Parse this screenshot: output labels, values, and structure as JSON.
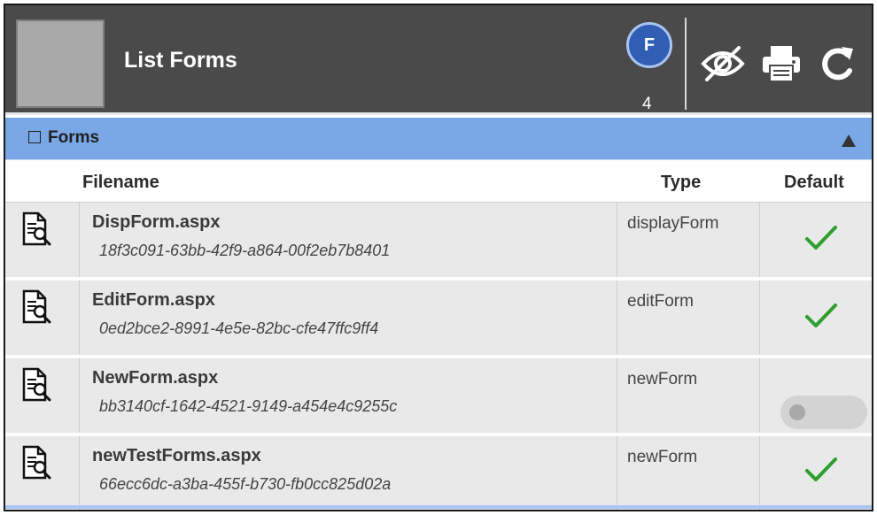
{
  "header": {
    "title": "List Forms",
    "badge_letter": "F",
    "badge_count": "4",
    "icons": [
      "hide-eye-icon",
      "print-icon",
      "refresh-icon"
    ]
  },
  "section": {
    "title": "Forms",
    "collapsed": false
  },
  "columns": {
    "filename": "Filename",
    "type": "Type",
    "default": "Default"
  },
  "rows": [
    {
      "name": "DispForm.aspx",
      "id": "18f3c091-63bb-42f9-a864-00f2eb7b8401",
      "type": "displayForm",
      "default": true
    },
    {
      "name": "EditForm.aspx",
      "id": "0ed2bce2-8991-4e5e-82bc-cfe47ffc9ff4",
      "type": "editForm",
      "default": true
    },
    {
      "name": "NewForm.aspx",
      "id": "bb3140cf-1642-4521-9149-a454e4c9255c",
      "type": "newForm",
      "default": false
    },
    {
      "name": "newTestForms.aspx",
      "id": "66ecc6dc-a3ba-455f-b730-fb0cc825d02a",
      "type": "newForm",
      "default": true
    }
  ],
  "colors": {
    "header_bg": "#4a4a4a",
    "section_bg": "#7aa7e6",
    "badge_bg": "#2f5eb4",
    "check_green": "#2e9e2e",
    "row_bg": "#e9e9e9"
  }
}
